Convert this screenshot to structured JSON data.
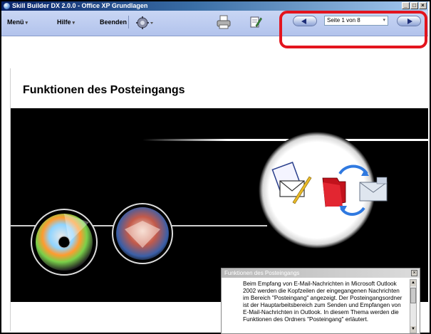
{
  "window": {
    "title": "Skill Builder DX 2.0.0 - Office XP Grundlagen",
    "minimize_glyph": "_",
    "maximize_glyph": "□",
    "close_glyph": "×"
  },
  "menu": {
    "items": [
      "Menü",
      "Hilfe",
      "Beenden"
    ]
  },
  "toolbar": {
    "icons": [
      "settings-icon",
      "print-icon",
      "notes-icon"
    ]
  },
  "navigation": {
    "page_label": "Seite 1 von 8",
    "highlight_color": "#e3141e"
  },
  "page": {
    "title": "Funktionen des Posteingangs"
  },
  "popup": {
    "title": "Funktionen des Posteingangs",
    "close_glyph": "×",
    "text": "Beim Empfang von E-Mail-Nachrichten in Microsoft Outlook 2002 werden die Kopfzeilen der eingegangenen Nachrichten im Bereich \"Posteingang\" angezeigt. Der Posteingangsordner ist der Hauptarbeitsbereich zum Senden und Empfangen von E-Mail-Nachrichten in Outlook. In diesem Thema werden die Funktionen des Ordners \"Posteingang\" erläutert."
  },
  "colors": {
    "stage_background": "#000000",
    "menubar": "#b9c8ee"
  }
}
